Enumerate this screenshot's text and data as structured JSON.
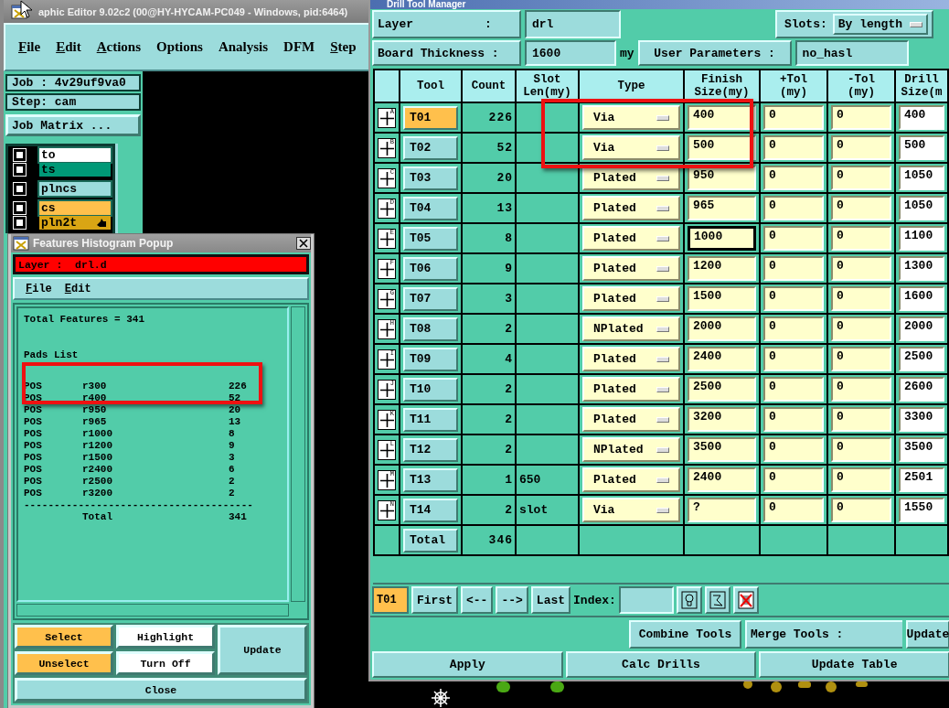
{
  "editor": {
    "title": "aphic Editor 9.02c2 (00@HY-HYCAM-PC049 - Windows, pid:6464)",
    "menu": [
      {
        "label": "File",
        "mnemonic": true
      },
      {
        "label": "Edit",
        "mnemonic": true
      },
      {
        "label": "Actions",
        "mnemonic": true
      },
      {
        "label": "Options",
        "mnemonic": false
      },
      {
        "label": "Analysis",
        "mnemonic": false
      },
      {
        "label": "DFM",
        "mnemonic": false
      },
      {
        "label": "Step",
        "mnemonic": true
      }
    ],
    "job": "Job : 4v29uf9va0",
    "step": "Step: cam",
    "job_matrix": "Job Matrix ...",
    "layers": [
      {
        "name": "to",
        "color": "#ffffff",
        "checked": false,
        "current": false,
        "new_group": true
      },
      {
        "name": "ts",
        "color": "#009977",
        "checked": false,
        "current": false,
        "new_group": false
      },
      {
        "name": "plncs",
        "color": "#9cdcdc",
        "checked": false,
        "current": false,
        "new_group": true
      },
      {
        "name": "cs",
        "color": "#ffc04c",
        "checked": false,
        "current": false,
        "new_group": true
      },
      {
        "name": "pln2t",
        "color": "#d9a514",
        "checked": false,
        "current": true,
        "new_group": false
      }
    ]
  },
  "histogram": {
    "title": "Features Histogram Popup",
    "layer": "Layer :  drl.d",
    "menu": [
      "File",
      "Edit"
    ],
    "summary": "Total Features = 341",
    "section": "Pads List",
    "rows": [
      {
        "polarity": "POS",
        "symbol": "r300",
        "count": "226"
      },
      {
        "polarity": "POS",
        "symbol": "r400",
        "count": "52"
      },
      {
        "polarity": "POS",
        "symbol": "r950",
        "count": "20"
      },
      {
        "polarity": "POS",
        "symbol": "r965",
        "count": "13"
      },
      {
        "polarity": "POS",
        "symbol": "r1000",
        "count": "8"
      },
      {
        "polarity": "POS",
        "symbol": "r1200",
        "count": "9"
      },
      {
        "polarity": "POS",
        "symbol": "r1500",
        "count": "3"
      },
      {
        "polarity": "POS",
        "symbol": "r2400",
        "count": "6"
      },
      {
        "polarity": "POS",
        "symbol": "r2500",
        "count": "2"
      },
      {
        "polarity": "POS",
        "symbol": "r3200",
        "count": "2"
      }
    ],
    "separator": "--------------------------------------",
    "total_label": "Total",
    "total": "341",
    "buttons": [
      {
        "label": "Select",
        "color": "#ffc04c"
      },
      {
        "label": "Highlight",
        "color": "#ffffff"
      },
      {
        "label": "Update",
        "color": "#9cdcdc"
      },
      {
        "label": "Unselect",
        "color": "#ffc04c"
      },
      {
        "label": "Turn Off",
        "color": "#ffffff"
      }
    ],
    "close": "Close"
  },
  "drill": {
    "title": "Drill Tool Manager",
    "layer_label": "Layer          :",
    "layer": "drl",
    "slots_label": "Slots:",
    "slots": "By length",
    "thickness_label": "Board Thickness :",
    "thickness": "1600",
    "thickness_unit": "my",
    "user_params_label": "User Parameters :",
    "user_params": "no_hasl",
    "columns": [
      "Tool",
      "Count",
      "Slot\nLen(my)",
      "Type",
      "Finish\nSize(my)",
      "+Tol\n(my)",
      "-Tol\n(my)",
      "Drill\nSize(m"
    ],
    "rows": [
      {
        "key": "A",
        "tool": "T01",
        "selected": true,
        "count": "226",
        "type": "Via",
        "finish": "400",
        "plus_tol": "0",
        "minus_tol": "0",
        "drill": "400",
        "focused": false
      },
      {
        "key": "B",
        "tool": "T02",
        "selected": false,
        "count": "52",
        "type": "Via",
        "finish": "500",
        "plus_tol": "0",
        "minus_tol": "0",
        "drill": "500",
        "focused": false
      },
      {
        "key": "C",
        "tool": "T03",
        "selected": false,
        "count": "20",
        "type": "Plated",
        "finish": "950",
        "plus_tol": "0",
        "minus_tol": "0",
        "drill": "1050",
        "focused": false
      },
      {
        "key": "D",
        "tool": "T04",
        "selected": false,
        "count": "13",
        "type": "Plated",
        "finish": "965",
        "plus_tol": "0",
        "minus_tol": "0",
        "drill": "1050",
        "focused": false
      },
      {
        "key": "E",
        "tool": "T05",
        "selected": false,
        "count": "8",
        "type": "Plated",
        "finish": "1000",
        "plus_tol": "0",
        "minus_tol": "0",
        "drill": "1100",
        "focused": true
      },
      {
        "key": "F",
        "tool": "T06",
        "selected": false,
        "count": "9",
        "type": "Plated",
        "finish": "1200",
        "plus_tol": "0",
        "minus_tol": "0",
        "drill": "1300",
        "focused": false
      },
      {
        "key": "G",
        "tool": "T07",
        "selected": false,
        "count": "3",
        "type": "Plated",
        "finish": "1500",
        "plus_tol": "0",
        "minus_tol": "0",
        "drill": "1600",
        "focused": false
      },
      {
        "key": "H",
        "tool": "T08",
        "selected": false,
        "count": "2",
        "type": "NPlated",
        "finish": "2000",
        "plus_tol": "0",
        "minus_tol": "0",
        "drill": "2000",
        "focused": false
      },
      {
        "key": "I",
        "tool": "T09",
        "selected": false,
        "count": "4",
        "type": "Plated",
        "finish": "2400",
        "plus_tol": "0",
        "minus_tol": "0",
        "drill": "2500",
        "focused": false
      },
      {
        "key": "J",
        "tool": "T10",
        "selected": false,
        "count": "2",
        "type": "Plated",
        "finish": "2500",
        "plus_tol": "0",
        "minus_tol": "0",
        "drill": "2600",
        "focused": false
      },
      {
        "key": "K",
        "tool": "T11",
        "selected": false,
        "count": "2",
        "type": "Plated",
        "finish": "3200",
        "plus_tol": "0",
        "minus_tol": "0",
        "drill": "3300",
        "focused": false
      },
      {
        "key": "L",
        "tool": "T12",
        "selected": false,
        "count": "2",
        "type": "NPlated",
        "finish": "3500",
        "plus_tol": "0",
        "minus_tol": "0",
        "drill": "3500",
        "focused": false
      },
      {
        "key": "M",
        "tool": "T13",
        "selected": false,
        "count": "1",
        "slot_len": "650",
        "type": "Plated",
        "finish": "2400",
        "plus_tol": "0",
        "minus_tol": "0",
        "drill": "2501",
        "focused": false
      },
      {
        "key": "N",
        "tool": "T14",
        "selected": false,
        "count": "2",
        "slot_len": "slot",
        "type": "Via",
        "finish": "?",
        "plus_tol": "0",
        "minus_tol": "0",
        "drill": "1550",
        "focused": false
      }
    ],
    "total_label": "Total",
    "total": "346",
    "current_tool": "T01",
    "nav": [
      "First",
      "<--",
      "-->",
      "Last"
    ],
    "index_label": "Index:",
    "combine": "Combine Tools",
    "merge_label": "Merge Tools :",
    "merge_button": "Update",
    "actions": [
      "Apply",
      "Calc Drills",
      "Update Table"
    ]
  }
}
